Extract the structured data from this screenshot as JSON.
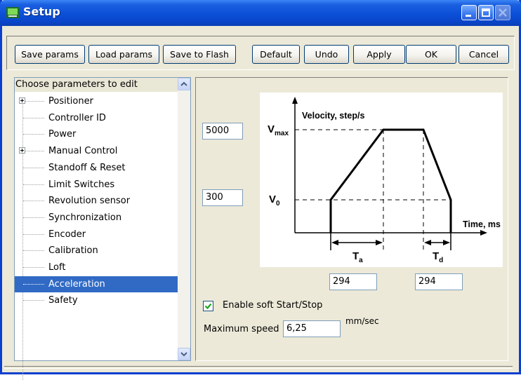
{
  "window": {
    "title": "Setup",
    "title_color": "#ffffff",
    "accent": "#0a45c8",
    "selection_color": "#316ac5"
  },
  "toolbar": {
    "save_params": "Save params",
    "load_params": "Load params",
    "save_to_flash": "Save to Flash",
    "default": "Default",
    "undo": "Undo",
    "apply": "Apply",
    "ok": "OK",
    "cancel": "Cancel"
  },
  "tree": {
    "header": "Choose parameters to edit",
    "items": [
      {
        "label": "Positioner",
        "expandable": true,
        "selected": false
      },
      {
        "label": "Controller ID",
        "expandable": false,
        "selected": false
      },
      {
        "label": "Power",
        "expandable": false,
        "selected": false
      },
      {
        "label": "Manual Control",
        "expandable": true,
        "selected": false
      },
      {
        "label": "Standoff & Reset",
        "expandable": false,
        "selected": false
      },
      {
        "label": "Limit Switches",
        "expandable": false,
        "selected": false
      },
      {
        "label": "Revolution sensor",
        "expandable": false,
        "selected": false
      },
      {
        "label": "Synchronization",
        "expandable": false,
        "selected": false
      },
      {
        "label": "Encoder",
        "expandable": false,
        "selected": false
      },
      {
        "label": "Calibration",
        "expandable": false,
        "selected": false
      },
      {
        "label": "Loft",
        "expandable": false,
        "selected": false
      },
      {
        "label": "Acceleration",
        "expandable": false,
        "selected": true
      },
      {
        "label": "Safety",
        "expandable": false,
        "selected": false
      }
    ]
  },
  "diagram": {
    "y_axis_label": "Velocity, step/s",
    "x_axis_label": "Time, ms",
    "vmax_label": "V",
    "vmax_sub": "max",
    "v0_label": "V",
    "v0_sub": "0",
    "ta_label": "T",
    "ta_sub": "a",
    "td_label": "T",
    "td_sub": "d"
  },
  "fields": {
    "vmax_value": "5000",
    "v0_value": "300",
    "ta_value": "294",
    "td_value": "294",
    "max_speed_value": "6,25"
  },
  "options": {
    "soft_start_label": "Enable soft Start/Stop",
    "soft_start_checked": true,
    "max_speed_label": "Maximum speed",
    "max_speed_unit": "mm/sec"
  },
  "icons": {
    "app": "app-icon",
    "minimize": "minimize-icon",
    "maximize": "maximize-icon",
    "close": "close-icon",
    "expand": "plus-box-icon",
    "scroll_up": "chevron-up-icon",
    "scroll_down": "chevron-down-icon",
    "check": "checkmark-icon"
  }
}
